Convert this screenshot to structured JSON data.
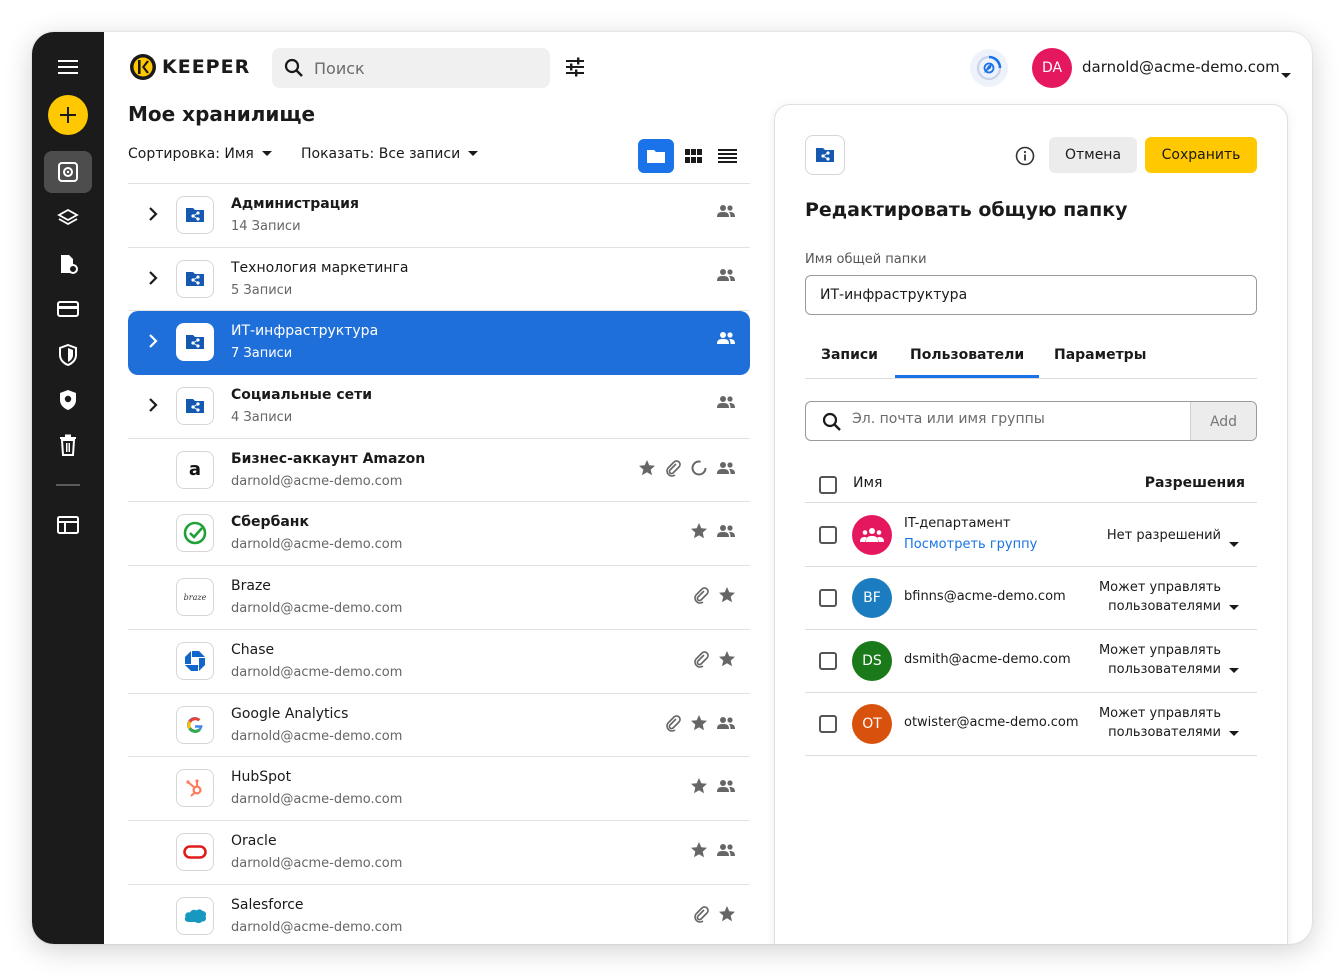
{
  "app": {
    "brand": "KEEPER"
  },
  "search": {
    "placeholder": "Поиск"
  },
  "user": {
    "initials": "DA",
    "email": "darnold@acme-demo.com",
    "avatar_color": "#e5175f"
  },
  "vault": {
    "title": "Мое хранилище",
    "sort_label": "Сортировка: Имя",
    "show_label": "Показать: Все записи"
  },
  "list": {
    "rows": [
      {
        "title": "Администрация",
        "sub": "14 Записи",
        "type": "folder",
        "bold": true
      },
      {
        "title": "Технология маркетинга",
        "sub": "5 Записи",
        "type": "folder",
        "bold": false
      },
      {
        "title": "ИТ-инфраструктура",
        "sub": "7 Записи",
        "type": "folder",
        "bold": false,
        "selected": true
      },
      {
        "title": "Социальные сети",
        "sub": "4 Записи",
        "type": "folder",
        "bold": true
      },
      {
        "title": "Бизнес-аккаунт Amazon",
        "sub": "darnold@acme-demo.com",
        "type": "record",
        "bold": true,
        "icon": "amazon-icon"
      },
      {
        "title": "Сбербанк",
        "sub": "darnold@acme-demo.com",
        "type": "record",
        "bold": true,
        "icon": "sberbank-icon"
      },
      {
        "title": "Braze",
        "sub": "darnold@acme-demo.com",
        "type": "record",
        "bold": false,
        "icon": "braze-icon"
      },
      {
        "title": "Chase",
        "sub": "darnold@acme-demo.com",
        "type": "record",
        "bold": false,
        "icon": "chase-icon"
      },
      {
        "title": "Google Analytics",
        "sub": "darnold@acme-demo.com",
        "type": "record",
        "bold": false,
        "icon": "google-icon"
      },
      {
        "title": "HubSpot",
        "sub": "darnold@acme-demo.com",
        "type": "record",
        "bold": false,
        "icon": "hubspot-icon"
      },
      {
        "title": "Oracle",
        "sub": "darnold@acme-demo.com",
        "type": "record",
        "bold": false,
        "icon": "oracle-icon"
      },
      {
        "title": "Salesforce",
        "sub": "darnold@acme-demo.com",
        "type": "record",
        "bold": false,
        "icon": "salesforce-icon"
      }
    ],
    "amazon_glyph": "a",
    "braze_glyph": "braze"
  },
  "panel": {
    "cancel_label": "Отмена",
    "save_label": "Сохранить",
    "title": "Редактировать общую папку",
    "folder_name_label": "Имя общей папки",
    "folder_name_value": "ИТ-инфраструктура",
    "tabs": [
      "Записи",
      "Пользователи",
      "Параметры"
    ],
    "active_tab": "Пользователи",
    "user_search_placeholder": "Эл. почта или имя группы",
    "add_label": "Add",
    "col_name": "Имя",
    "col_perm": "Разрешения",
    "users": [
      {
        "name": "IT-департамент",
        "link": "Посмотреть группу",
        "perm": "Нет разрешений",
        "initials": "",
        "color": "#e5175f"
      },
      {
        "name": "bfinns@acme-demo.com",
        "perm": "Может управлять пользователями",
        "initials": "BF",
        "color": "#1b7cbf"
      },
      {
        "name": "dsmith@acme-demo.com",
        "perm": "Может управлять пользователями",
        "initials": "DS",
        "color": "#1a7a1a"
      },
      {
        "name": "otwister@acme-demo.com",
        "perm": "Может управлять пользователями",
        "initials": "OT",
        "color": "#d8520d"
      }
    ]
  },
  "colors": {
    "accent": "#1a73e8",
    "save": "#ffc800",
    "rail": "#1b1b1b"
  }
}
